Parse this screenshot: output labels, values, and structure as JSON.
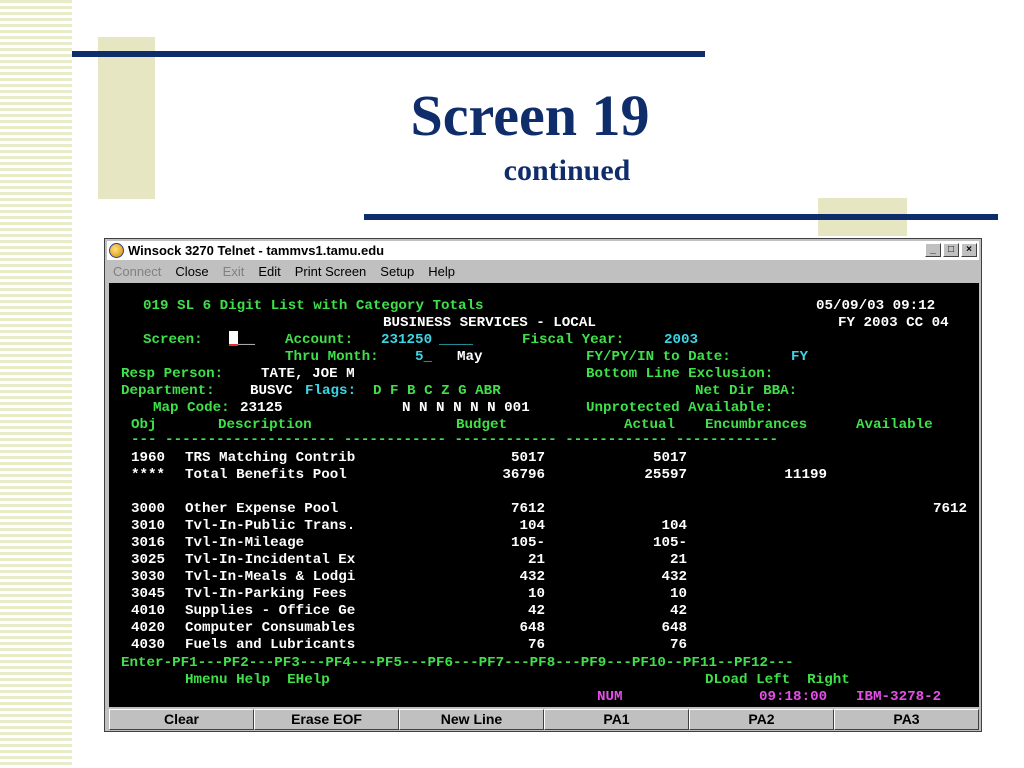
{
  "slide": {
    "title": "Screen 19",
    "subtitle": "continued"
  },
  "window": {
    "title": "Winsock 3270 Telnet - tammvs1.tamu.edu",
    "menu": [
      {
        "label": "Connect",
        "enabled": false
      },
      {
        "label": "Close",
        "enabled": true
      },
      {
        "label": "Exit",
        "enabled": false
      },
      {
        "label": "Edit",
        "enabled": true
      },
      {
        "label": "Print Screen",
        "enabled": true
      },
      {
        "label": "Setup",
        "enabled": true
      },
      {
        "label": "Help",
        "enabled": true
      }
    ],
    "controls": {
      "minimize": "_",
      "maximize": "□",
      "close": "×"
    }
  },
  "terminal": {
    "header": {
      "line1": "019 SL 6 Digit List with Category Totals",
      "datetime": "05/09/03 09:12",
      "org": "BUSINESS SERVICES - LOCAL",
      "fy_cc": "FY 2003 CC 04"
    },
    "screen_label": "Screen:",
    "account_label": "Account:",
    "account_value": "231250",
    "account_blank": "____",
    "fiscal_year_label": "Fiscal Year:",
    "fiscal_year_value": "2003",
    "thru_month_label": "Thru Month:",
    "thru_month_value": "5_",
    "thru_month_name": "May",
    "to_date_label": "FY/PY/IN to Date:",
    "to_date_value": "FY",
    "resp_person_label": "Resp Person:",
    "resp_person_value": "TATE, JOE M",
    "bottom_line_label": "Bottom Line Exclusion:",
    "department_label": "Department:",
    "department_value": "BUSVC",
    "flags_label": "Flags:",
    "flags_letters": "D F B C Z G ABR",
    "net_dir_label": "Net Dir BBA:",
    "map_code_label": "Map Code:",
    "map_code_value": "23125",
    "flags_values": "N N N N N N 001",
    "unprotected_label": "Unprotected Available:",
    "columns": [
      "Obj",
      "Description",
      "Budget",
      "Actual",
      "Encumbrances",
      "Available"
    ],
    "separator": "--- -------------------- ------------ ------------ ------------ ------------",
    "rows": [
      {
        "obj": "1960",
        "desc": "TRS Matching Contrib",
        "budget": "5017",
        "actual": "5017",
        "enc": "",
        "avail": ""
      },
      {
        "obj": "****",
        "desc": "Total Benefits Pool",
        "budget": "36796",
        "actual": "25597",
        "enc": "11199",
        "avail": ""
      },
      {
        "obj": "",
        "desc": "",
        "budget": "",
        "actual": "",
        "enc": "",
        "avail": ""
      },
      {
        "obj": "3000",
        "desc": "Other Expense Pool",
        "budget": "7612",
        "actual": "",
        "enc": "",
        "avail": "7612"
      },
      {
        "obj": "3010",
        "desc": "Tvl-In-Public Trans.",
        "budget": "104",
        "actual": "104",
        "enc": "",
        "avail": ""
      },
      {
        "obj": "3016",
        "desc": "Tvl-In-Mileage",
        "budget": "105-",
        "actual": "105-",
        "enc": "",
        "avail": ""
      },
      {
        "obj": "3025",
        "desc": "Tvl-In-Incidental Ex",
        "budget": "21",
        "actual": "21",
        "enc": "",
        "avail": ""
      },
      {
        "obj": "3030",
        "desc": "Tvl-In-Meals & Lodgi",
        "budget": "432",
        "actual": "432",
        "enc": "",
        "avail": ""
      },
      {
        "obj": "3045",
        "desc": "Tvl-In-Parking Fees",
        "budget": "10",
        "actual": "10",
        "enc": "",
        "avail": ""
      },
      {
        "obj": "4010",
        "desc": "Supplies - Office Ge",
        "budget": "42",
        "actual": "42",
        "enc": "",
        "avail": ""
      },
      {
        "obj": "4020",
        "desc": "Computer Consumables",
        "budget": "648",
        "actual": "648",
        "enc": "",
        "avail": ""
      },
      {
        "obj": "4030",
        "desc": "Fuels and Lubricants",
        "budget": "76",
        "actual": "76",
        "enc": "",
        "avail": ""
      }
    ],
    "pf_line": "Enter-PF1---PF2---PF3---PF4---PF5---PF6---PF7---PF8---PF9---PF10--PF11--PF12---",
    "pf_labels_left": "Hmenu Help  EHelp",
    "pf_labels_right": "DLoad Left  Right",
    "status_num": "NUM",
    "status_time": "09:18:00",
    "status_term": "IBM-3278-2"
  },
  "keys": [
    "Clear",
    "Erase EOF",
    "New Line",
    "PA1",
    "PA2",
    "PA3"
  ],
  "colors": {
    "title": "#0f2d6b",
    "rule": "#0f2d6b",
    "accent_block": "#e6e6c3",
    "terminal_green": "#3fe04a",
    "terminal_cyan": "#3bd6e6",
    "terminal_magenta": "#e54fe8"
  }
}
